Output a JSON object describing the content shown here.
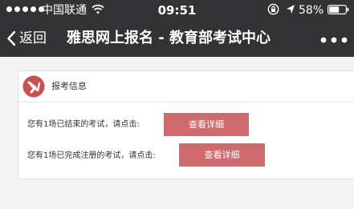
{
  "status_bar": {
    "carrier": "中国联通",
    "time": "09:51",
    "battery": "58%"
  },
  "nav": {
    "back_label": "返回",
    "title": "雅思网上报名 - 教育部考试中心"
  },
  "card": {
    "title": "报考信息",
    "rows": [
      {
        "text": "您有1场已结束的考试，请点击:",
        "button": "查看详细"
      },
      {
        "text": "您有1场已完成注册的考试，请点击:",
        "button": "查看详细"
      }
    ]
  },
  "colors": {
    "nav_bg": "#333336",
    "accent": "#cf6b6e",
    "page_bg": "#f4f4f4"
  },
  "icons": [
    "wifi-icon",
    "lock-rotation-icon",
    "location-icon",
    "battery-icon",
    "back-chevron-icon",
    "more-icon",
    "arrow-circle-icon"
  ]
}
